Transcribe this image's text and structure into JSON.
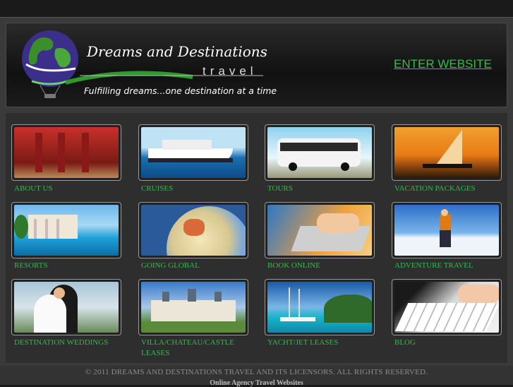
{
  "brand": {
    "title": "Dreams and Destinations",
    "subtitle": "travel",
    "tagline": "Fulfilling dreams...one destination at a time"
  },
  "header": {
    "enter_label": "ENTER WEBSITE"
  },
  "tiles": [
    {
      "label": "ABOUT US",
      "icon": "ruins-image"
    },
    {
      "label": "CRUISES",
      "icon": "cruise-ship-image"
    },
    {
      "label": "TOURS",
      "icon": "tour-bus-image"
    },
    {
      "label": "VACATION PACKAGES",
      "icon": "sailboat-sunset-image"
    },
    {
      "label": "RESORTS",
      "icon": "resort-pool-image"
    },
    {
      "label": "GOING GLOBAL",
      "icon": "globe-image"
    },
    {
      "label": "BOOK ONLINE",
      "icon": "laptop-typing-image"
    },
    {
      "label": "ADVENTURE TRAVEL",
      "icon": "snow-hiker-image"
    },
    {
      "label": "DESTINATION WEDDINGS",
      "icon": "wedding-couple-image"
    },
    {
      "label": "VILLA/CHATEAU/CASTLE LEASES",
      "icon": "chateau-image"
    },
    {
      "label": "YACHT/JET LEASES",
      "icon": "yacht-image"
    },
    {
      "label": "BLOG",
      "icon": "keyboard-image"
    }
  ],
  "footer": {
    "copyright": "© 2011 DREAMS AND DESTINATIONS TRAVEL AND ITS LICENSORS. ALL RIGHTS RESERVED.",
    "credit": "Online Agency Travel Websites"
  },
  "colors": {
    "accent": "#2fbf4a",
    "background": "#1a1a1a"
  }
}
